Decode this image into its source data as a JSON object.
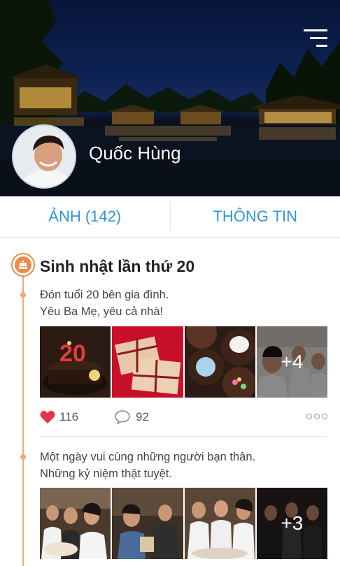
{
  "profile": {
    "name": "Quốc Hùng",
    "menu_icon": "menu-icon"
  },
  "tabs": [
    {
      "label": "ẢNH (142)"
    },
    {
      "label": "THÔNG TIN"
    }
  ],
  "feed": {
    "album_title": "Sinh nhật lần thứ 20",
    "album_icon": "cake-icon",
    "posts": [
      {
        "caption_lines": [
          "Đón tuổi 20 bên gia đình.",
          "Yêu Ba Mẹ, yêu cả nhà!"
        ],
        "more_photos": "+4",
        "likes": "116",
        "comments": "92"
      },
      {
        "caption_lines": [
          "Một ngày vui cùng những người bạn thân.",
          "Những kỷ niệm thật tuyệt."
        ],
        "more_photos": "+3"
      }
    ]
  },
  "colors": {
    "accent": "#2f97d8",
    "timeline": "#f5a677",
    "like": "#e2344d"
  }
}
